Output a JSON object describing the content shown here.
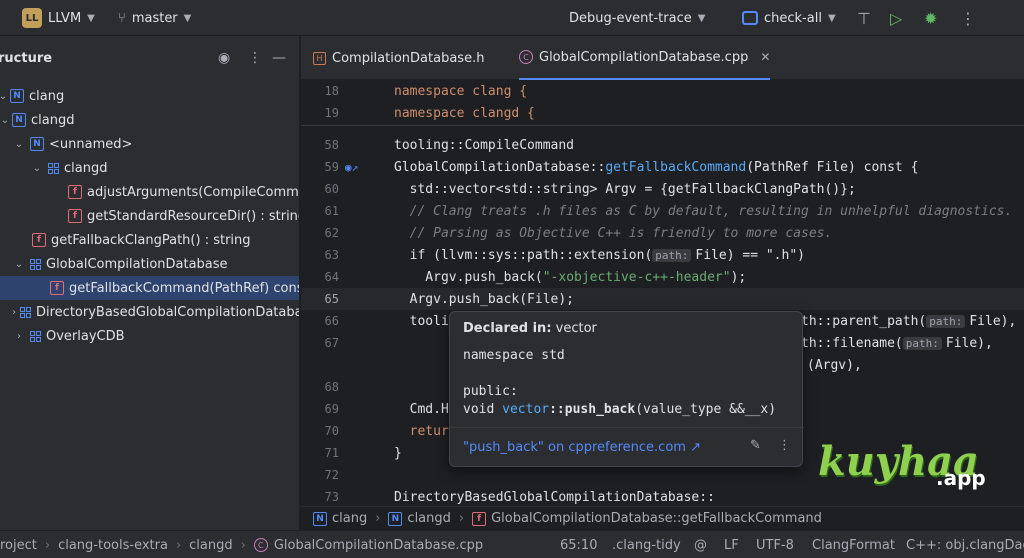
{
  "topbar": {
    "project_badge": "LL",
    "project_name": "LLVM",
    "branch": "master",
    "run_config": "Debug-event-trace",
    "target": "check-all"
  },
  "structure": {
    "title": "ructure",
    "items": [
      {
        "label": "clang"
      },
      {
        "label": "clangd"
      },
      {
        "label": "<unnamed>"
      },
      {
        "label": "clangd"
      },
      {
        "label": "adjustArguments(CompileComman"
      },
      {
        "label": "getStandardResourceDir() : string"
      },
      {
        "label": "getFallbackClangPath() : string"
      },
      {
        "label": "GlobalCompilationDatabase"
      },
      {
        "label": "getFallbackCommand(PathRef) const"
      },
      {
        "label": "DirectoryBasedGlobalCompilationDataba"
      },
      {
        "label": "OverlayCDB"
      }
    ]
  },
  "tabs": [
    {
      "label": "CompilationDatabase.h"
    },
    {
      "label": "GlobalCompilationDatabase.cpp"
    }
  ],
  "editor": {
    "line_numbers": [
      "18",
      "19",
      "58",
      "59",
      "60",
      "61",
      "62",
      "63",
      "64",
      "65",
      "66",
      "67",
      "68",
      "69",
      "70",
      "71",
      "72",
      "73"
    ],
    "line_18": "namespace clang {",
    "line_19": "namespace clangd {",
    "line_58": "tooling::CompileCommand",
    "line_59_class": "GlobalCompilationDatabase::",
    "line_59_fn": "getFallbackCommand",
    "line_59_rest": "(PathRef File) const {",
    "line_60": "  std::vector<std::string> Argv = {getFallbackClangPath()};",
    "line_61": "  // Clang treats .h files as C by default, resulting in unhelpful diagnostics.",
    "line_62": "  // Parsing as Objective C++ is friendly to more cases.",
    "line_63_a": "  if (llvm::sys::path::extension(",
    "line_63_hint": "path:",
    "line_63_b": "File) == \".h\")",
    "line_64_a": "    Argv.push_back(",
    "line_64_str": "\"-xobjective-c++-header\"",
    "line_64_b": ");",
    "line_65": "  Argv.push_back(File);",
    "line_66_a": "  tooli",
    "line_66_b": "th::parent_path(",
    "line_66_hint": "path:",
    "line_66_c": "File),",
    "line_67_b": "th::filename(",
    "line_67_hint": "path:",
    "line_67_c": "File),",
    "line_68_c": "(Argv),",
    "line_69_a": "  Cmd.H",
    "line_70_a": "  retur",
    "line_71": "}",
    "line_73": "DirectoryBasedGlobalCompilationDatabase::"
  },
  "popup": {
    "declared_label": "Declared in:",
    "declared_value": "vector",
    "namespace_line": "namespace std",
    "public_line": "public:",
    "sig_void": "void ",
    "sig_class": "vector",
    "sig_fn": "::push_back",
    "sig_rest": "(value_type &&__x)",
    "link_text": "\"push_back\" on cppreference.com ↗"
  },
  "breadcrumbs": [
    "clang",
    "clangd",
    "GlobalCompilationDatabase::getFallbackCommand"
  ],
  "statusbar": {
    "path": [
      "roject",
      "clang-tools-extra",
      "clangd",
      "GlobalCompilationDatabase.cpp"
    ],
    "position": "65:10",
    "linter": ".clang-tidy",
    "line_sep": "LF",
    "encoding": "UTF-8",
    "formatter": "ClangFormat",
    "context": "C++: obj.clangDae"
  },
  "watermark": {
    "text": "kuyhaa",
    "suffix": ".app"
  },
  "colors": {
    "accent": "#548af7",
    "keyword": "#cf8e6d",
    "string": "#6aab73",
    "selection": "#2e436e"
  }
}
